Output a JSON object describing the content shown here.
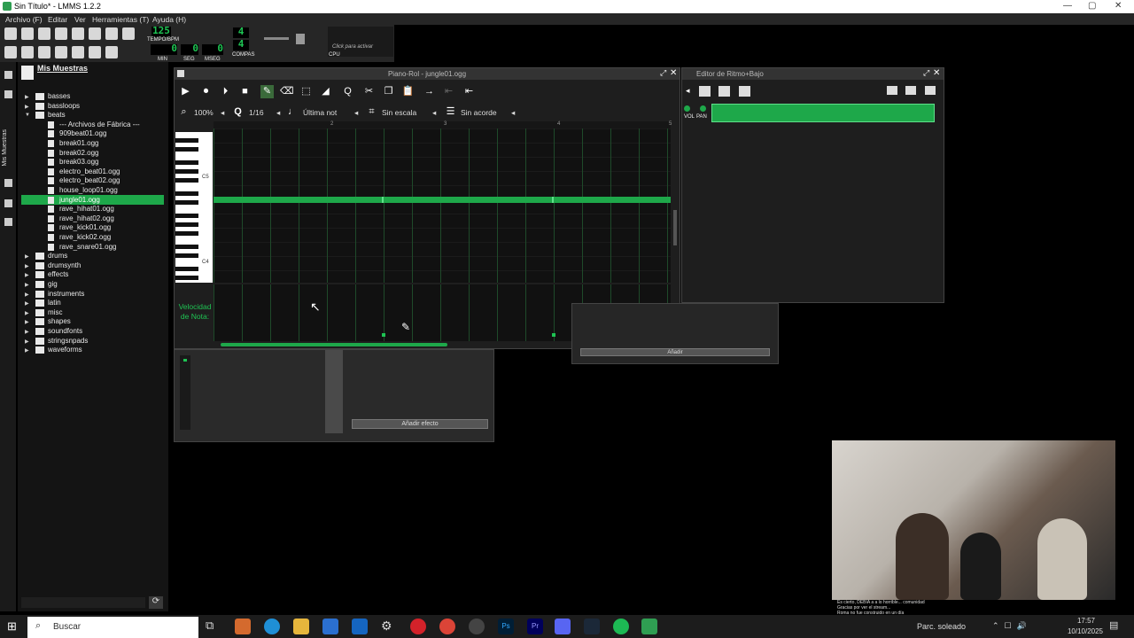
{
  "window": {
    "title": "Sin Título* - LMMS 1.2.2",
    "minimize": "—",
    "maximize": "▢",
    "close": "✕"
  },
  "menu": [
    "Archivo (F)",
    "Editar",
    "Ver",
    "Herramientas (T)",
    "Ayuda (H)"
  ],
  "toolbar": {
    "tempo_value": "125",
    "tempo_label": "TEMPO/BPM",
    "min_value": "0",
    "min_label": "MIN",
    "sec_value": "0",
    "sec_label": "SEG",
    "msec_value": "0",
    "msec_label": "MSEG",
    "compas_top": "4",
    "compas_bottom": "4",
    "compas_label": "COMPAS",
    "cpu_hint": "Click para activar",
    "cpu_label": "CPU"
  },
  "sidebar": {
    "title": "Mis Muestras",
    "vertical_label": "Mis Muestras",
    "folders_top": [
      "basses",
      "bassloops",
      "beats"
    ],
    "factory_label": "--- Archivos de Fábrica ---",
    "beat_files": [
      "909beat01.ogg",
      "break01.ogg",
      "break02.ogg",
      "break03.ogg",
      "electro_beat01.ogg",
      "electro_beat02.ogg",
      "house_loop01.ogg",
      "jungle01.ogg",
      "rave_hihat01.ogg",
      "rave_hihat02.ogg",
      "rave_kick01.ogg",
      "rave_kick02.ogg",
      "rave_snare01.ogg"
    ],
    "selected_file": "jungle01.ogg",
    "folders_bottom": [
      "drums",
      "drumsynth",
      "effects",
      "gig",
      "instruments",
      "latin",
      "misc",
      "shapes",
      "soundfonts",
      "stringsnpads",
      "waveforms"
    ]
  },
  "piano_roll": {
    "title": "Piano-Rol - jungle01.ogg",
    "zoom": "100%",
    "quantize": "1/16",
    "note_length": "Última not",
    "scale": "Sin escala",
    "chord": "Sin acorde",
    "bar_numbers": [
      "2",
      "3",
      "4",
      "5"
    ],
    "key_labels": [
      "C5",
      "C4"
    ],
    "velocity_label": "Velocidad de Nota:"
  },
  "beat_editor": {
    "title": "Editor de Ritmo+Bajo",
    "vol_label": "VOL",
    "pan_label": "PAN",
    "add_label": "Añadir"
  },
  "mixer": {
    "add_effect": "Añadir efecto"
  },
  "chat_overlay": [
    "Es cierto, DEBIA a a lo horrible... comunidad",
    "Gracias por ver el stream...",
    "Roma no fue construido en un día"
  ],
  "taskbar": {
    "search_placeholder": "Buscar",
    "weather": "Parc. soleado",
    "time": "17:57",
    "date": "10/10/2025"
  },
  "colors": {
    "accent": "#1ea84a",
    "lcd_green": "#1ec453",
    "background": "#000000"
  }
}
